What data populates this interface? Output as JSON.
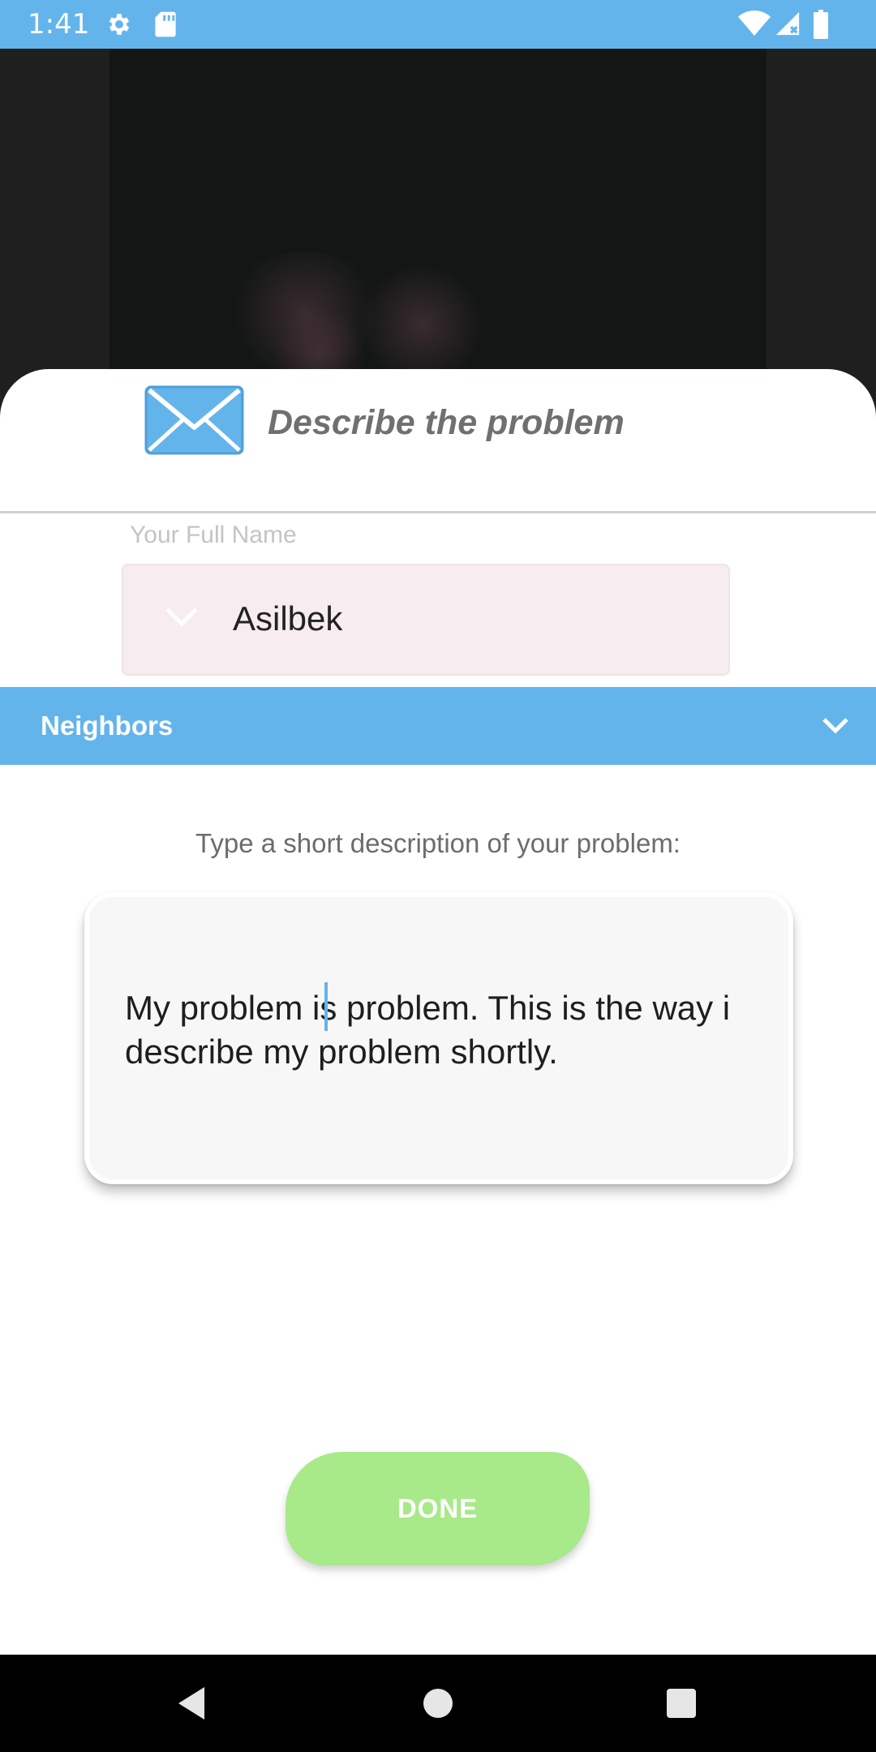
{
  "status_bar": {
    "time": "1:41",
    "left_icons": [
      "gear-icon",
      "sd-card-icon"
    ],
    "right_icons": [
      "wifi-icon",
      "signal-icon",
      "battery-icon"
    ],
    "color": "#64b4ec"
  },
  "sheet": {
    "title": "Describe the problem",
    "name_field": {
      "label": "Your Full Name",
      "value": "Asilbek"
    },
    "group_dropdown": {
      "label": "Neighbors"
    },
    "description": {
      "prompt": "Type a short description of your problem:",
      "value": "My problem is problem. This is the way i describe my problem shortly."
    },
    "done_label": "DONE"
  },
  "colors": {
    "accent": "#64b4ec",
    "done_button": "#a8e98a",
    "name_field_bg": "#f7ecef"
  }
}
